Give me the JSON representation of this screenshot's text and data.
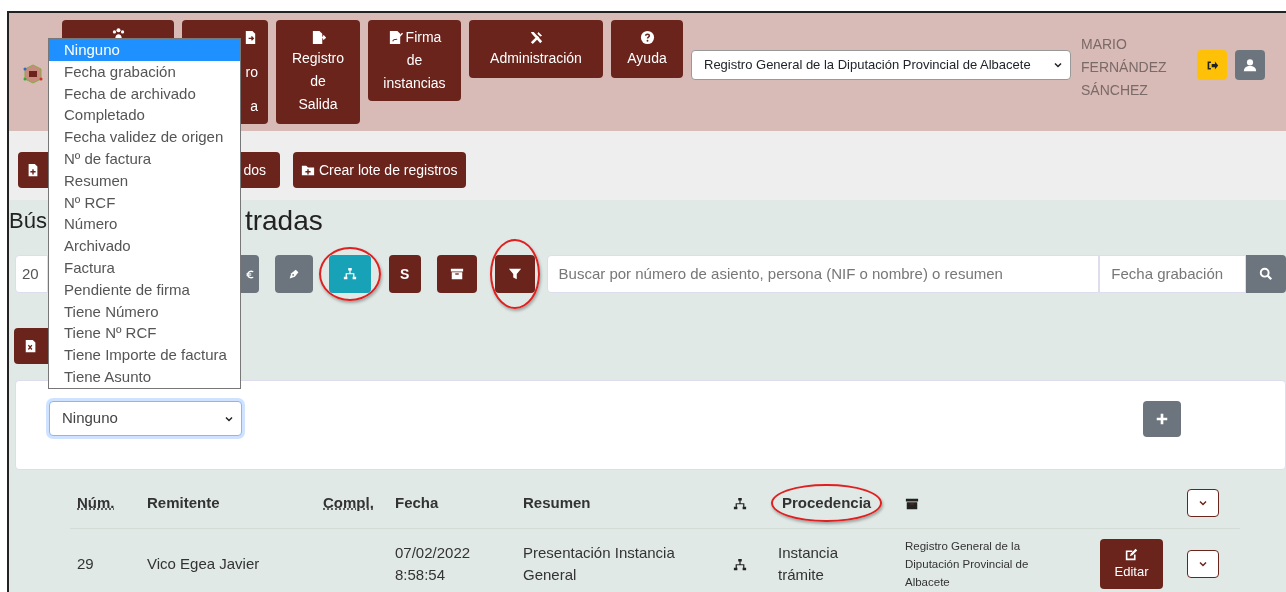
{
  "header": {
    "nav_buttons": [
      {
        "kind": "people"
      },
      {
        "kind": "file-in",
        "lines": [
          "ro",
          "a"
        ]
      },
      {
        "kind": "file-out",
        "lines": [
          "Registro",
          "de",
          "Salida"
        ]
      },
      {
        "kind": "signature",
        "lines": [
          "Firma",
          "de",
          "instancias"
        ]
      },
      {
        "kind": "tools",
        "lines": [
          "Administración"
        ]
      },
      {
        "kind": "help",
        "lines": [
          "Ayuda"
        ]
      }
    ],
    "office_select": {
      "value": "Registro General de la Diputación Provincial de Albacete"
    },
    "user_name": "MARIO FERNÁNDEZ SÁNCHEZ"
  },
  "actions": [
    {
      "kind": "file-plus",
      "label": "dos"
    },
    {
      "kind": "folder-plus",
      "label": "Crear lote de registros"
    }
  ],
  "title_fragments": [
    "Bús",
    "tradas"
  ],
  "toolbar": {
    "year_field": {
      "value": "20"
    },
    "buttons": [
      {
        "kind": "euro",
        "highlighted": false
      },
      {
        "kind": "pen",
        "highlighted": false
      },
      {
        "kind": "sitemap",
        "highlighted": true
      },
      {
        "kind": "letter",
        "label": "S",
        "highlighted": false
      },
      {
        "kind": "archive",
        "highlighted": false
      },
      {
        "kind": "filter",
        "highlighted": true
      }
    ],
    "search": {
      "placeholder": "Buscar por número de asiento, persona (NIF o nombre) o resumen"
    },
    "date_field": {
      "placeholder": "Fecha grabación"
    }
  },
  "export_button": {
    "kind": "excel"
  },
  "sort_panel": {
    "select": {
      "value": "Ninguno",
      "open": true,
      "options": [
        {
          "label": "Ninguno",
          "selected": true
        },
        {
          "label": "Fecha grabación",
          "selected": false
        },
        {
          "label": "Fecha de archivado",
          "selected": false
        },
        {
          "label": "Completado",
          "selected": false
        },
        {
          "label": "Fecha validez de origen",
          "selected": false
        },
        {
          "label": "Nº de factura",
          "selected": false
        },
        {
          "label": "Resumen",
          "selected": false
        },
        {
          "label": "Nº RCF",
          "selected": false
        },
        {
          "label": "Número",
          "selected": false
        },
        {
          "label": "Archivado",
          "selected": false
        },
        {
          "label": "Factura",
          "selected": false
        },
        {
          "label": "Pendiente de firma",
          "selected": false
        },
        {
          "label": "Tiene Número",
          "selected": false
        },
        {
          "label": "Tiene Nº RCF",
          "selected": false
        },
        {
          "label": "Tiene Importe de factura",
          "selected": false
        },
        {
          "label": "Tiene Asunto",
          "selected": false
        }
      ]
    }
  },
  "table": {
    "columns": [
      {
        "kind": "abbr",
        "label": "Núm.",
        "highlighted": false
      },
      {
        "kind": "text",
        "label": "Remitente",
        "highlighted": false
      },
      {
        "kind": "abbr",
        "label": "Compl.",
        "highlighted": false
      },
      {
        "kind": "text",
        "label": "Fecha",
        "highlighted": false
      },
      {
        "kind": "text",
        "label": "Resumen",
        "highlighted": false
      },
      {
        "kind": "sitemap",
        "highlighted": false
      },
      {
        "kind": "text",
        "label": "Procedencia",
        "highlighted": true
      },
      {
        "kind": "archive",
        "highlighted": false
      },
      {
        "kind": "blank"
      },
      {
        "kind": "toggle",
        "highlighted": false
      }
    ],
    "rows": [
      {
        "num": "29",
        "sender": "Vico Egea Javier",
        "date": "07/02/2022",
        "time": "8:58:54",
        "summary": "Presentación Instancia General",
        "origin": "Instancia trámite",
        "office": "Registro General de la Diputación Provincial de Albacete",
        "edit_label": "Editar"
      }
    ]
  }
}
